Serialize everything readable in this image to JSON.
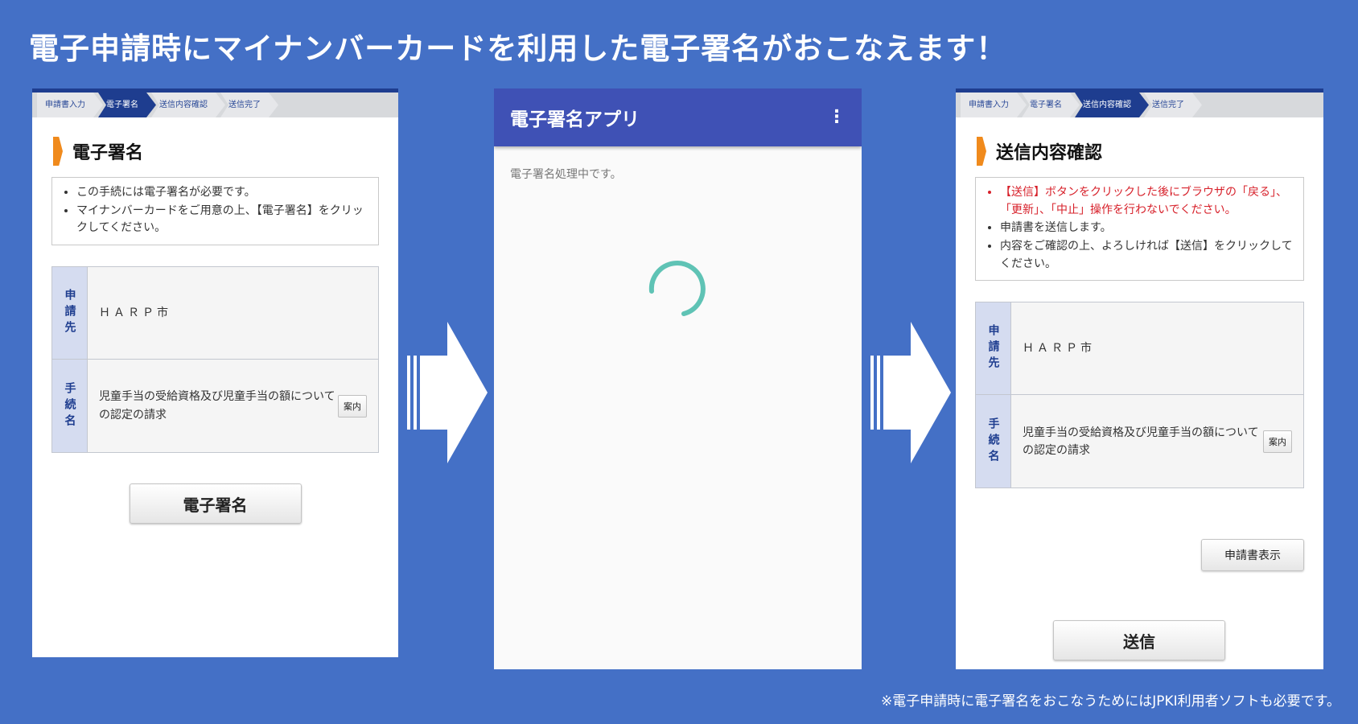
{
  "headline": "電子申請時にマイナンバーカードを利用した電子署名がおこなえます！",
  "footnote": "※電子申請時に電子署名をおこなうためにはJPKI利用者ソフトも必要です。",
  "colors": {
    "background": "#4470c6",
    "accent": "#1e3d8f",
    "orange": "#f08a1c",
    "appbar": "#3f51b5",
    "spinner": "#5fc3b5",
    "warning": "#d7202a"
  },
  "left": {
    "steps": [
      "申請書入力",
      "電子署名",
      "送信内容確認",
      "送信完了"
    ],
    "active_step": 1,
    "section_title": "電子署名",
    "notices": [
      "この手続には電子署名が必要です。",
      "マイナンバーカードをご用意の上、【電子署名】をクリックしてください。"
    ],
    "table": {
      "dest_label": "申請先",
      "dest_value": "ＨＡＲＰ市",
      "proc_label": "手続名",
      "proc_value": "児童手当の受給資格及び児童手当の額についての認定の請求",
      "guide_label": "案内"
    },
    "sign_button": "電子署名"
  },
  "middle": {
    "app_title": "電子署名アプリ",
    "menu_icon": "kebab-menu-icon",
    "status": "電子署名処理中です。"
  },
  "right": {
    "steps": [
      "申請書入力",
      "電子署名",
      "送信内容確認",
      "送信完了"
    ],
    "active_step": 2,
    "section_title": "送信内容確認",
    "warning": "【送信】ボタンをクリックした後にブラウザの「戻る」、「更新」、「中止」操作を行わないでください。",
    "notices": [
      "申請書を送信します。",
      "内容をご確認の上、よろしければ【送信】をクリックしてください。"
    ],
    "table": {
      "dest_label": "申請先",
      "dest_value": "ＨＡＲＰ市",
      "proc_label": "手続名",
      "proc_value": "児童手当の受給資格及び児童手当の額についての認定の請求",
      "guide_label": "案内"
    },
    "view_button": "申請書表示",
    "send_button": "送信"
  }
}
